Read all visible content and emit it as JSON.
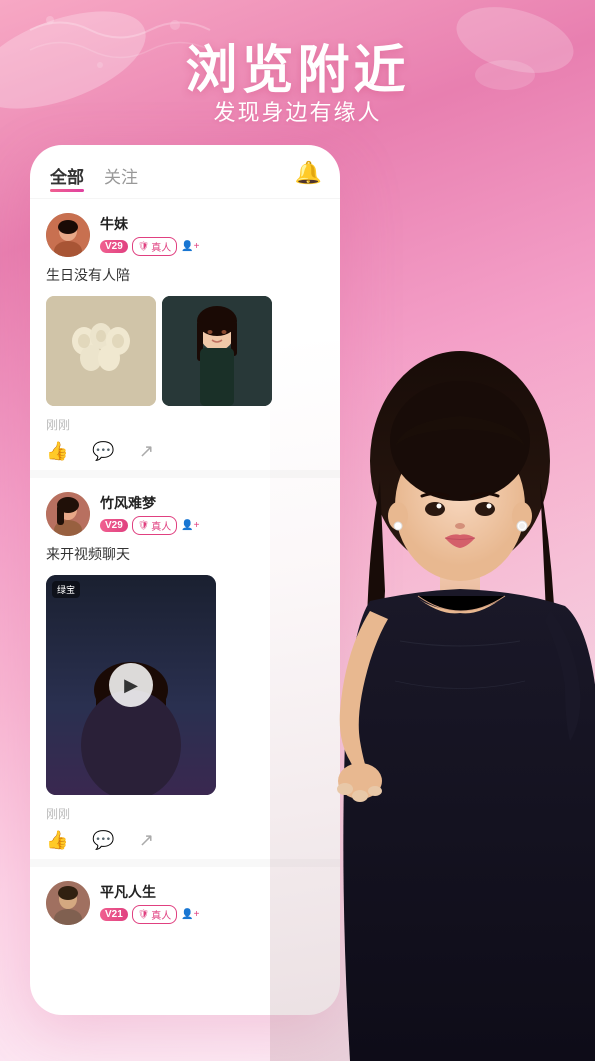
{
  "background": {
    "gradient_start": "#f4a0c8",
    "gradient_end": "#fce8f3"
  },
  "hero": {
    "title": "浏览附近",
    "subtitle": "发现身边有缘人"
  },
  "tabs": {
    "active": "全部",
    "inactive": "关注",
    "bell_label": "通知"
  },
  "posts": [
    {
      "username": "牛妹",
      "level_tag": "V29",
      "real_tag": "真人",
      "text": "生日没有人陪",
      "timestamp": "刚刚",
      "images": [
        "food",
        "girl"
      ],
      "actions": {
        "like": "",
        "comment": "",
        "share": ""
      }
    },
    {
      "username": "竹风难梦",
      "level_tag": "V29",
      "real_tag": "真人",
      "text": "来开视频聊天",
      "timestamp": "刚刚",
      "video_label": "绿宝",
      "actions": {
        "like": "",
        "comment": "",
        "share": ""
      }
    },
    {
      "username": "平凡人生",
      "level_tag": "V21",
      "real_tag": "真人",
      "text": "",
      "timestamp": "",
      "images": []
    }
  ]
}
